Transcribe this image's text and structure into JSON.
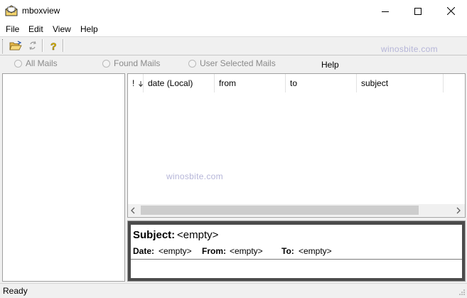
{
  "window": {
    "title": "mboxview",
    "icon": "envelope-app-icon",
    "controls": [
      "minimize",
      "maximize",
      "close"
    ]
  },
  "menu": {
    "file": "File",
    "edit": "Edit",
    "view": "View",
    "help": "Help"
  },
  "toolbar": {
    "buttons": [
      "open-folder-icon",
      "refresh-icon",
      "help-question-icon"
    ],
    "watermark": "winosbite.com"
  },
  "filters": {
    "all_mails": "All Mails",
    "found_mails": "Found Mails",
    "user_selected_mails": "User Selected Mails",
    "help": "Help"
  },
  "list": {
    "columns": {
      "flag": "!",
      "date": "date (Local)",
      "from": "from",
      "to": "to",
      "subject": "subject"
    },
    "rows": [],
    "watermark": "winosbite.com"
  },
  "preview": {
    "subject_label": "Subject:",
    "subject_value": "<empty>",
    "date_label": "Date:",
    "date_value": "<empty>",
    "from_label": "From:",
    "from_value": "<empty>",
    "to_label": "To:",
    "to_value": "<empty>"
  },
  "status": {
    "text": "Ready"
  }
}
